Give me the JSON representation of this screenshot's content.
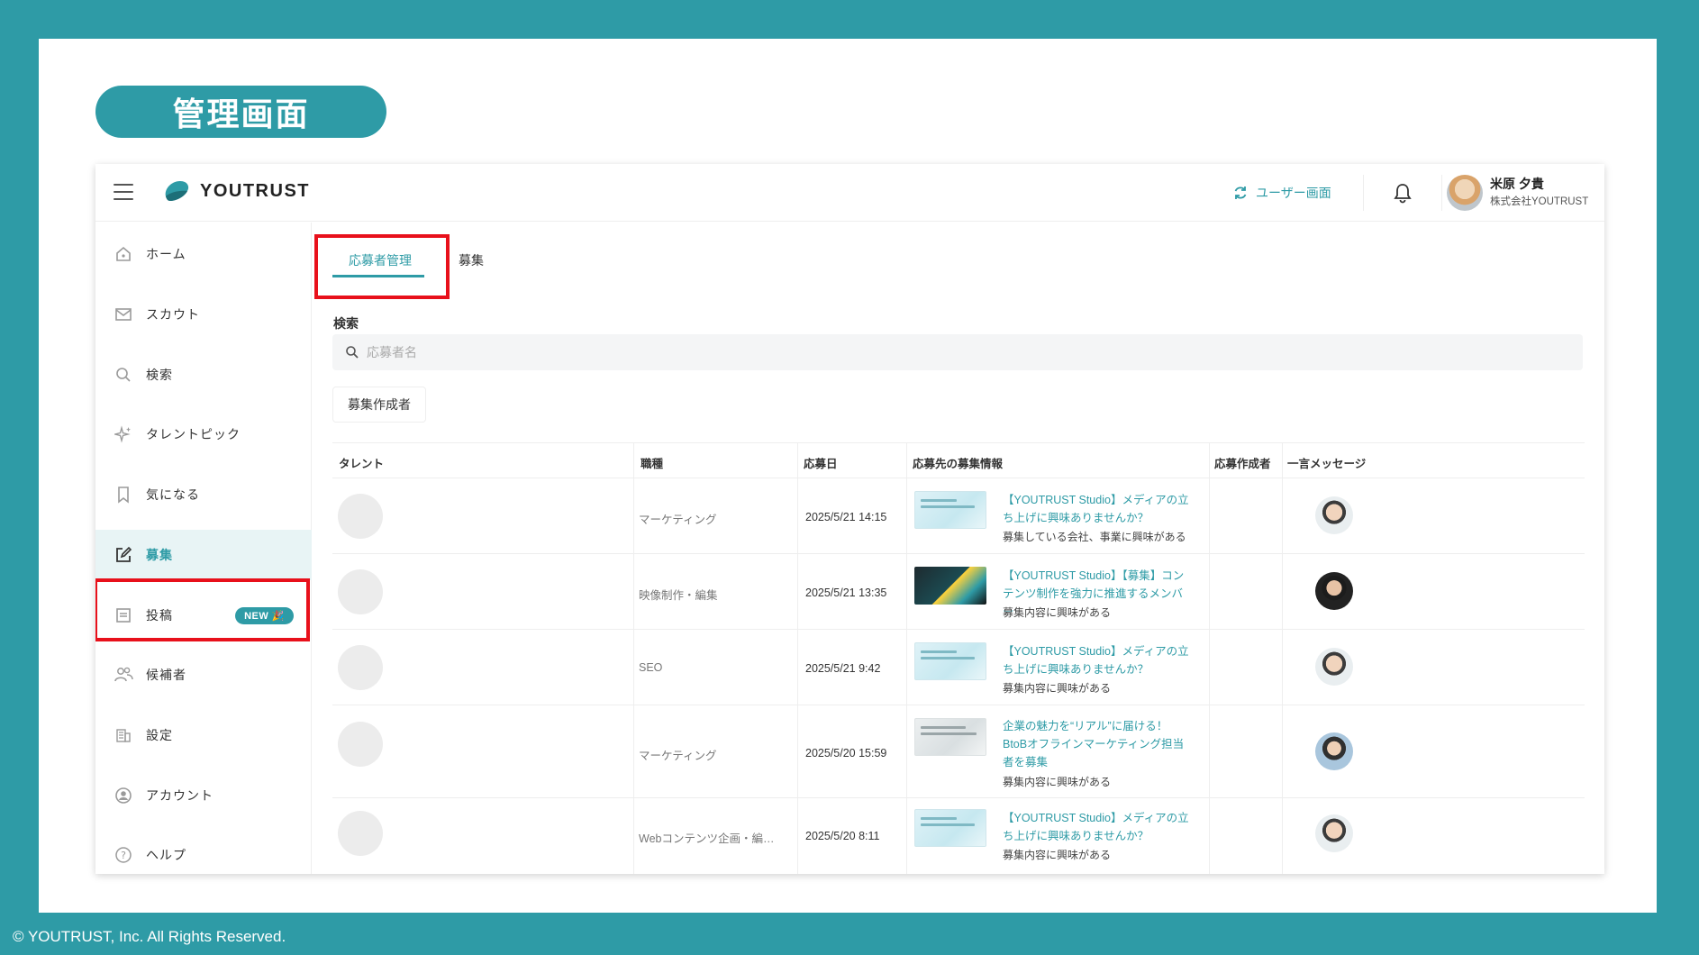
{
  "slide": {
    "title": "管理画面",
    "footer": "© YOUTRUST, Inc. All Rights Reserved."
  },
  "header": {
    "logo_text": "YOUTRUST",
    "user_screen_link": "ユーザー画面",
    "user_name": "米原 夕貴",
    "user_company": "株式会社YOUTRUST"
  },
  "sidebar": {
    "items": [
      {
        "label": "ホーム",
        "icon": "home-icon"
      },
      {
        "label": "スカウト",
        "icon": "mail-icon"
      },
      {
        "label": "検索",
        "icon": "search-icon"
      },
      {
        "label": "タレントピック",
        "icon": "sparkle-icon"
      },
      {
        "label": "気になる",
        "icon": "bookmark-icon"
      },
      {
        "label": "募集",
        "icon": "edit-icon",
        "active": true
      },
      {
        "label": "投稿",
        "icon": "post-icon",
        "badge": "NEW 🎉"
      },
      {
        "label": "候補者",
        "icon": "people-icon"
      },
      {
        "label": "設定",
        "icon": "building-icon"
      },
      {
        "label": "アカウント",
        "icon": "account-icon"
      },
      {
        "label": "ヘルプ",
        "icon": "help-icon"
      }
    ]
  },
  "main": {
    "tabs": [
      {
        "label": "応募者管理",
        "active": true
      },
      {
        "label": "募集"
      }
    ],
    "search": {
      "label": "検索",
      "placeholder": "応募者名"
    },
    "filter_button": "募集作成者",
    "table": {
      "columns": [
        "タレント",
        "職種",
        "応募日",
        "応募先の募集情報",
        "応募作成者",
        "一言メッセージ"
      ],
      "rows": [
        {
          "job_type": "マーケティング",
          "date": "2025/5/21 14:15",
          "posting_title": "【YOUTRUST Studio】メディアの立ち上げに興味ありませんか？",
          "posting_sub": "募集している会社、事業に興味がある"
        },
        {
          "job_type": "映像制作・編集",
          "date": "2025/5/21 13:35",
          "posting_title": "【YOUTRUST Studio】【募集】コンテンツ制作を強力に推進するメンバー",
          "posting_sub": "募集内容に興味がある"
        },
        {
          "job_type": "SEO",
          "date": "2025/5/21 9:42",
          "posting_title": "【YOUTRUST Studio】メディアの立ち上げに興味ありませんか？",
          "posting_sub": "募集内容に興味がある"
        },
        {
          "job_type": "マーケティング",
          "date": "2025/5/20 15:59",
          "posting_title": "企業の魅力を“リアル”に届ける！BtoBオフラインマーケティング担当者を募集",
          "posting_sub": "募集内容に興味がある"
        },
        {
          "job_type": "Webコンテンツ企画・編…",
          "date": "2025/5/20 8:11",
          "posting_title": "【YOUTRUST Studio】メディアの立ち上げに興味ありませんか？",
          "posting_sub": "募集内容に興味がある"
        }
      ]
    }
  },
  "colors": {
    "brand": "#2e9ba6",
    "highlight": "#e8101b"
  }
}
